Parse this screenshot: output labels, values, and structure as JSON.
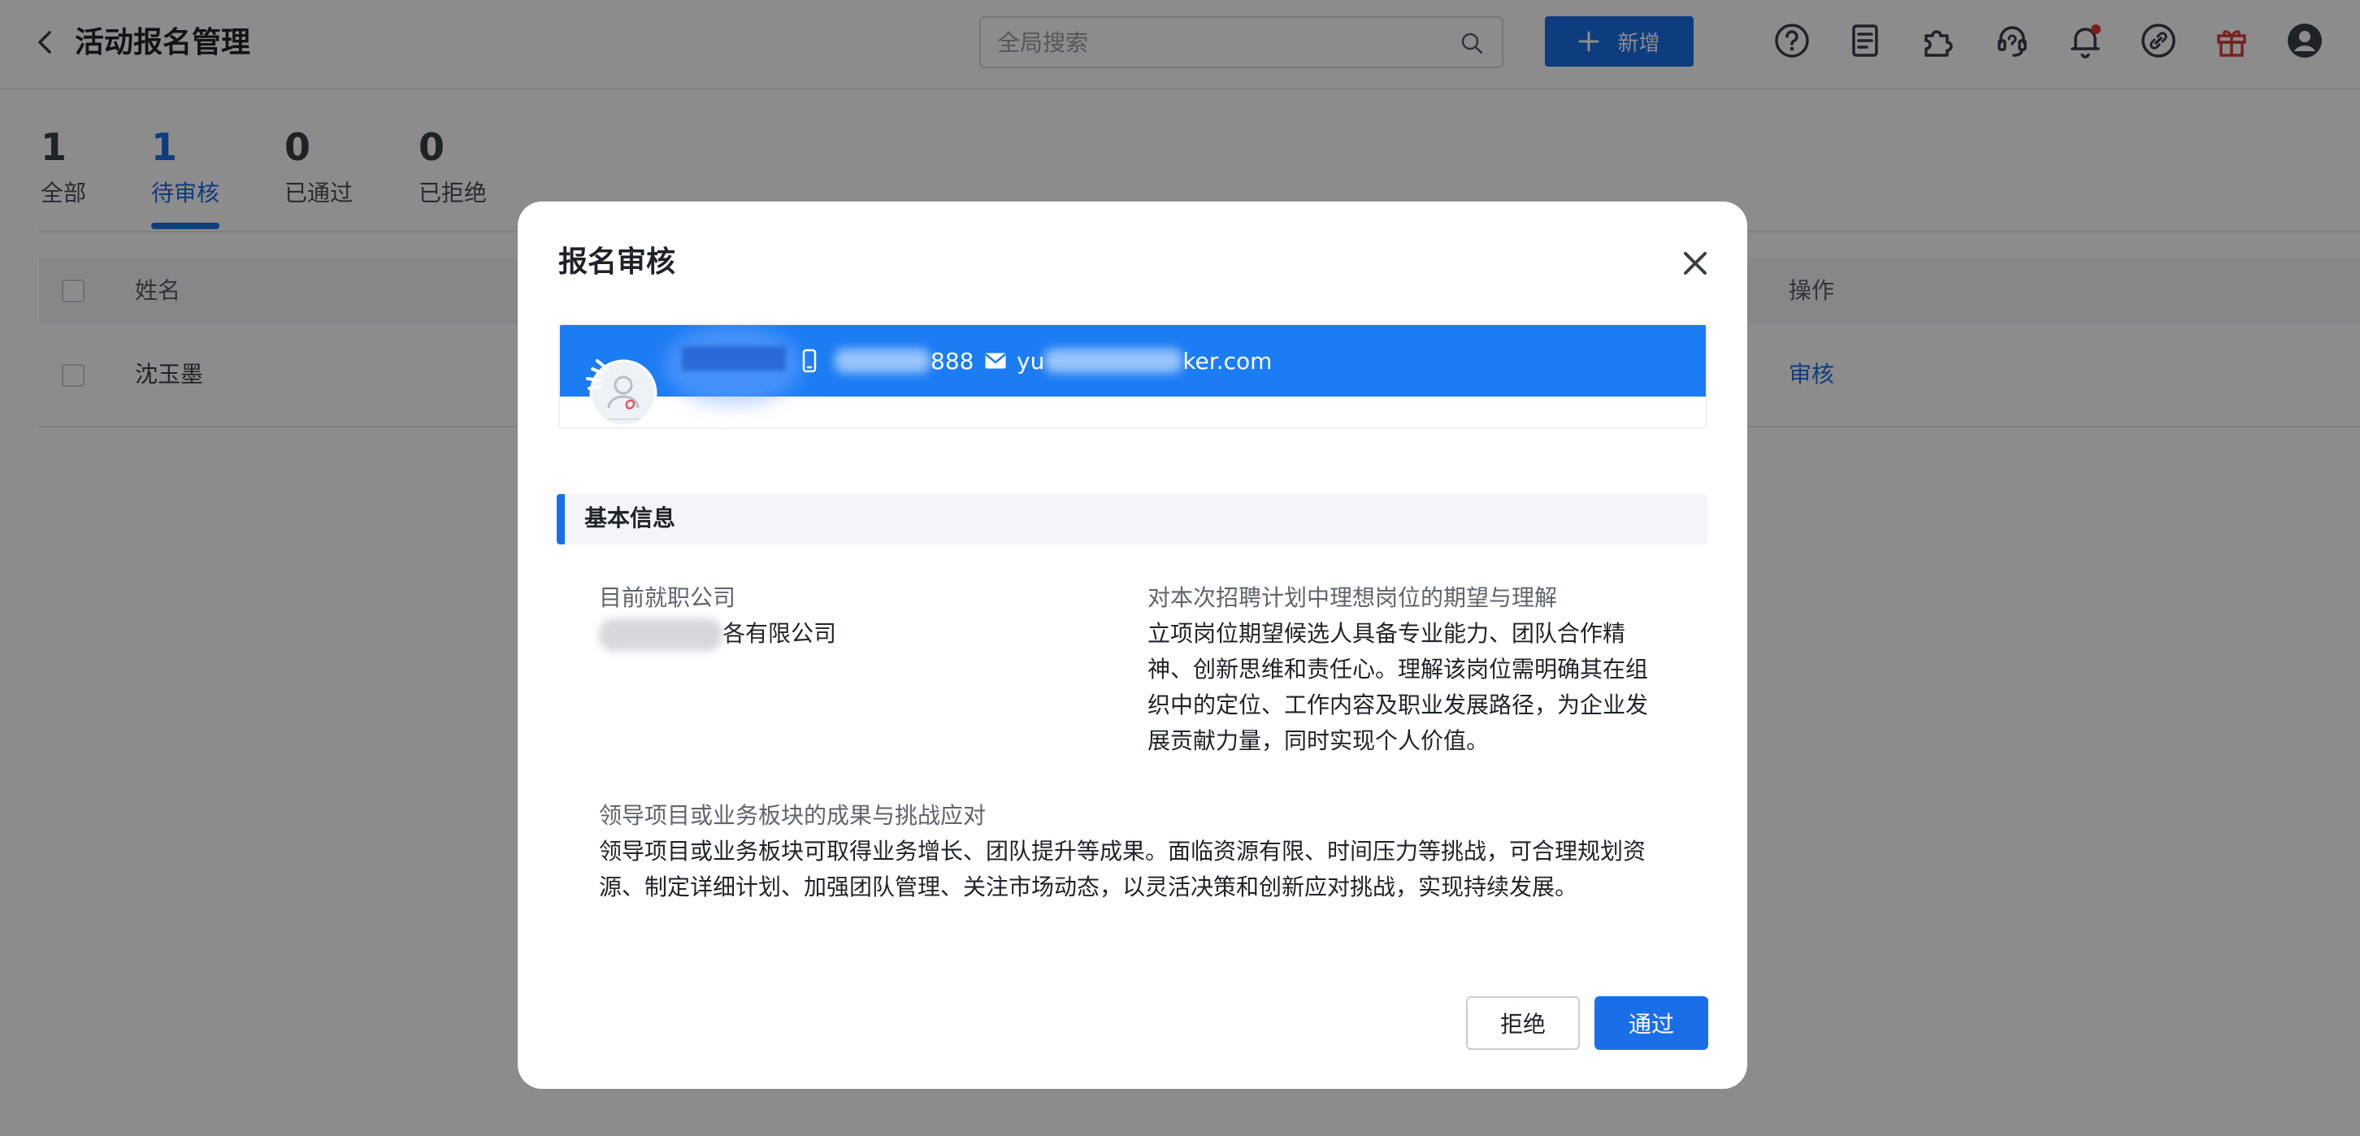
{
  "header": {
    "title": "活动报名管理",
    "search_placeholder": "全局搜索",
    "add_label": "新增",
    "colors": {
      "primary": "#1a6fe8",
      "gift": "#e23a3a",
      "notification_dot": "#e23a3a"
    }
  },
  "stats": [
    {
      "count": "1",
      "label": "全部"
    },
    {
      "count": "1",
      "label": "待审核"
    },
    {
      "count": "0",
      "label": "已通过"
    },
    {
      "count": "0",
      "label": "已拒绝"
    }
  ],
  "active_stat": "待审核",
  "table": {
    "headers": {
      "name": "姓名",
      "actions": "操作"
    },
    "rows": [
      {
        "name": "沈玉墨",
        "action": "审核"
      }
    ]
  },
  "modal": {
    "title": "报名审核",
    "profile": {
      "phone_suffix": "888",
      "email_prefix": "yu",
      "email_suffix": "ker.com"
    },
    "section_title": "基本信息",
    "fields": {
      "company": {
        "label": "目前就职公司",
        "value": "各有限公司"
      },
      "expectation": {
        "label": "对本次招聘计划中理想岗位的期望与理解",
        "lines": [
          "立项岗位期望候选人具备专业能力、团队合作精",
          "神、创新思维和责任心。理解该岗位需明确其在组",
          "织中的定位、工作内容及职业发展路径，为企业发",
          "展贡献力量，同时实现个人价值。"
        ]
      },
      "achievements": {
        "label": "领导项目或业务板块的成果与挑战应对",
        "lines": [
          "领导项目或业务板块可取得业务增长、团队提升等成果。面临资源有限、时间压力等挑战，可合理规划资",
          "源、制定详细计划、加强团队管理、关注市场动态，以灵活决策和创新应对挑战，实现持续发展。"
        ]
      }
    },
    "buttons": {
      "reject": "拒绝",
      "approve": "通过"
    }
  },
  "icons": [
    "back-icon",
    "search-icon",
    "plus-icon",
    "help-icon",
    "document-icon",
    "puzzle-icon",
    "headset-icon",
    "bell-icon",
    "link-icon",
    "gift-icon",
    "user-icon",
    "close-icon",
    "phone-icon",
    "mail-icon",
    "avatar-icon"
  ]
}
